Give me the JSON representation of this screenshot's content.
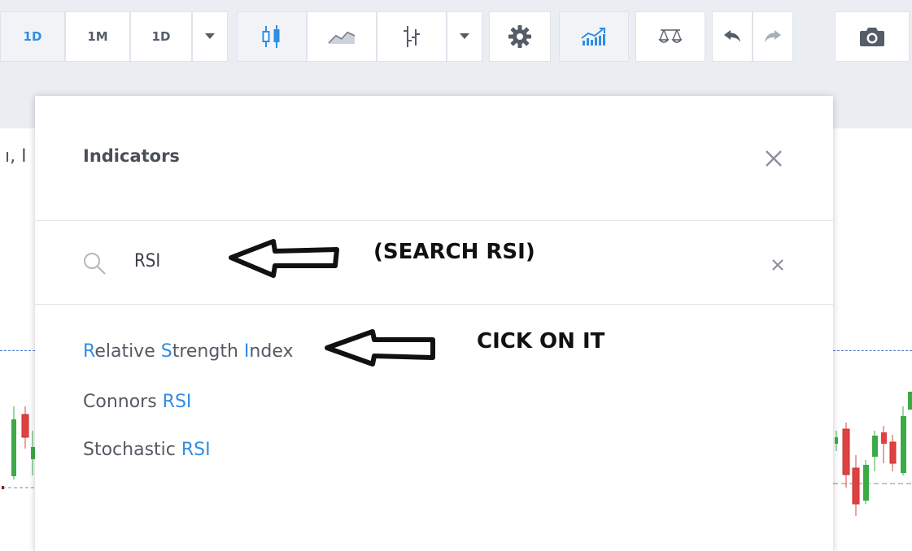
{
  "toolbar": {
    "interval_1d_active": "1D",
    "interval_1m": "1M",
    "interval_1d": "1D"
  },
  "chart": {
    "title_fragment": "ı, I"
  },
  "modal": {
    "title": "Indicators",
    "search": {
      "value": "RSI"
    },
    "results": [
      {
        "parts": [
          {
            "text": "R",
            "highlight": true
          },
          {
            "text": "elative ",
            "highlight": false
          },
          {
            "text": "S",
            "highlight": true
          },
          {
            "text": "trength ",
            "highlight": false
          },
          {
            "text": "I",
            "highlight": true
          },
          {
            "text": "ndex",
            "highlight": false
          }
        ]
      },
      {
        "parts": [
          {
            "text": "Connors ",
            "highlight": false
          },
          {
            "text": "RSI",
            "highlight": true
          }
        ]
      },
      {
        "parts": [
          {
            "text": "Stochastic ",
            "highlight": false
          },
          {
            "text": "RSI",
            "highlight": true
          }
        ]
      }
    ]
  },
  "annotations": {
    "search_hint": "(SEARCH RSI)",
    "click_hint": "CICK ON IT"
  },
  "colors": {
    "accent": "#2f8de4",
    "candle_up": "#3cab47",
    "candle_down": "#e0413f"
  }
}
